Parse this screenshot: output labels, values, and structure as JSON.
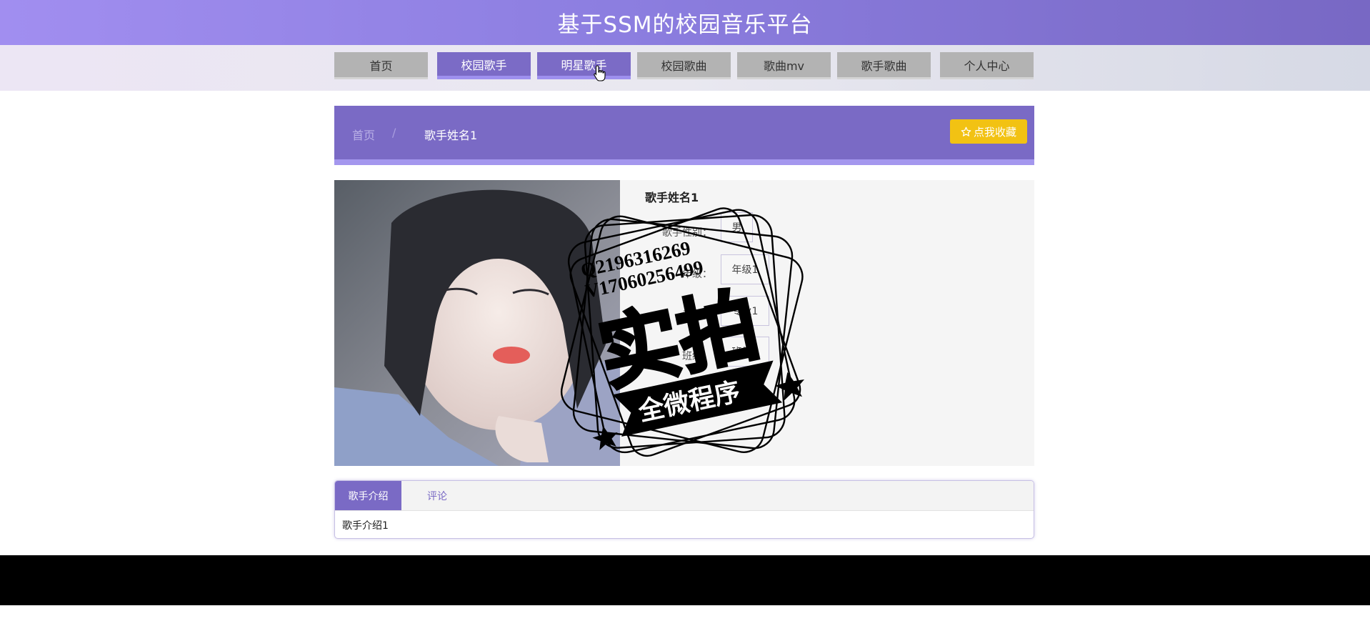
{
  "header": {
    "title": "基于SSM的校园音乐平台"
  },
  "nav": {
    "items": [
      {
        "label": "首页"
      },
      {
        "label": "校园歌手"
      },
      {
        "label": "明星歌手"
      },
      {
        "label": "校园歌曲"
      },
      {
        "label": "歌曲mv"
      },
      {
        "label": "歌手歌曲"
      },
      {
        "label": "个人中心"
      }
    ],
    "active": "校园歌手"
  },
  "breadcrumb": {
    "home": "首页",
    "separator": "/",
    "current": "歌手姓名1"
  },
  "favorite_button": {
    "label": "点我收藏",
    "icon": "star-outline-icon"
  },
  "singer": {
    "name": "歌手姓名1",
    "gender_label": "歌手性别：",
    "gender_value": "男",
    "grade_label": "年级：",
    "grade_value": "年级1",
    "major_label": "专业：",
    "major_value": "专业1",
    "class_label": "班级：",
    "class_value": "班级1"
  },
  "watermark": {
    "line1": "Q2196316269",
    "line2": "V17060256499",
    "main": "实拍",
    "ribbon": "全微程序"
  },
  "tabs": {
    "items": [
      {
        "label": "歌手介绍"
      },
      {
        "label": "评论"
      }
    ],
    "active": "歌手介绍",
    "content": "歌手介绍1"
  },
  "colors": {
    "accent": "#7a6ac5",
    "accent_light": "#a497ee",
    "favorite": "#f2c213",
    "footer": "#000000"
  }
}
